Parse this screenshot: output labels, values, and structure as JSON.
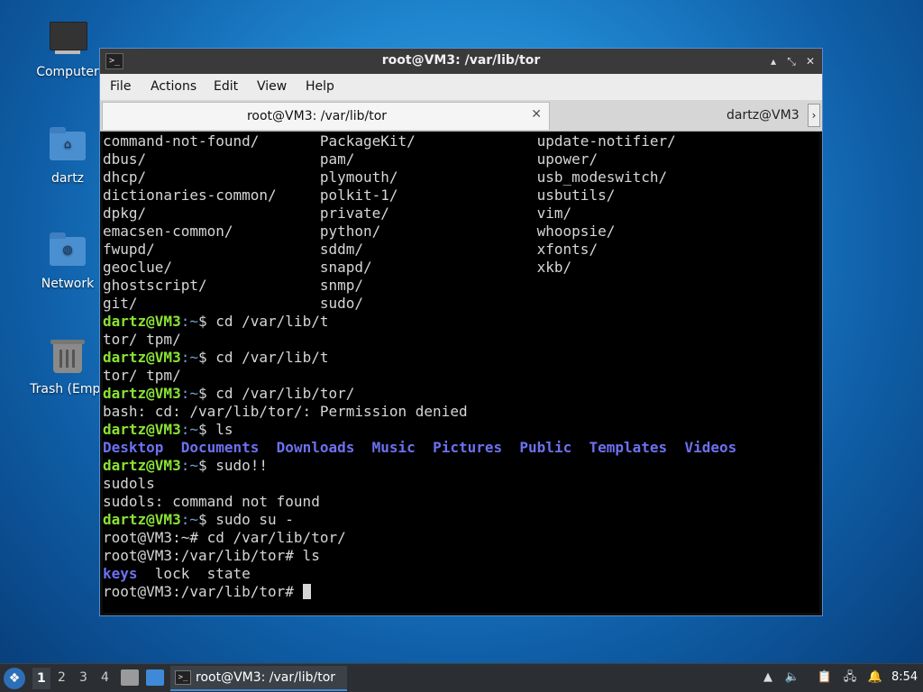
{
  "desktop": {
    "icons": [
      {
        "label": "Computer"
      },
      {
        "label": "dartz"
      },
      {
        "label": "Network"
      },
      {
        "label": "Trash (Empt"
      }
    ]
  },
  "window": {
    "title": "root@VM3: /var/lib/tor",
    "controls": {
      "minimize": "▴",
      "maximize": "⤡",
      "close": "✕"
    },
    "menu": [
      "File",
      "Actions",
      "Edit",
      "View",
      "Help"
    ],
    "tabs": [
      {
        "label": "root@VM3: /var/lib/tor",
        "close": "✕"
      },
      {
        "label": "dartz@VM3"
      }
    ],
    "tab_scroll": "›"
  },
  "terminal": {
    "listing": [
      [
        "command-not-found/",
        "PackageKit/",
        "update-notifier/"
      ],
      [
        "dbus/",
        "pam/",
        "upower/"
      ],
      [
        "dhcp/",
        "plymouth/",
        "usb_modeswitch/"
      ],
      [
        "dictionaries-common/",
        "polkit-1/",
        "usbutils/"
      ],
      [
        "dpkg/",
        "private/",
        "vim/"
      ],
      [
        "emacsen-common/",
        "python/",
        "whoopsie/"
      ],
      [
        "fwupd/",
        "sddm/",
        "xfonts/"
      ],
      [
        "geoclue/",
        "snapd/",
        "xkb/"
      ],
      [
        "ghostscript/",
        "snmp/",
        ""
      ],
      [
        "git/",
        "sudo/",
        ""
      ]
    ],
    "user_host": "dartz@VM3",
    "home_path": ":~",
    "prompt_sign": "$ ",
    "cmd1": "cd /var/lib/t",
    "completion": "tor/ tpm/",
    "cmd2": "cd /var/lib/t",
    "completion2": "tor/ tpm/",
    "cmd3": "cd /var/lib/tor/",
    "error": "bash: cd: /var/lib/tor/: Permission denied",
    "cmd4": "ls",
    "home_dirs": [
      "Desktop",
      "Documents",
      "Downloads",
      "Music",
      "Pictures",
      "Public",
      "Templates",
      "Videos"
    ],
    "cmd5": "sudo!!",
    "expanded": "sudols",
    "notfound": "sudols: command not found",
    "cmd6": "sudo su -",
    "root_line1": "root@VM3:~# cd /var/lib/tor/",
    "root_line2": "root@VM3:/var/lib/tor# ls",
    "tor_dir": "keys",
    "tor_files": "  lock  state",
    "root_prompt": "root@VM3:/var/lib/tor# "
  },
  "taskbar": {
    "start_icon": "start-menu-icon",
    "workspaces": [
      "1",
      "2",
      "3",
      "4"
    ],
    "task_title": "root@VM3: /var/lib/tor",
    "time": "8:54"
  }
}
